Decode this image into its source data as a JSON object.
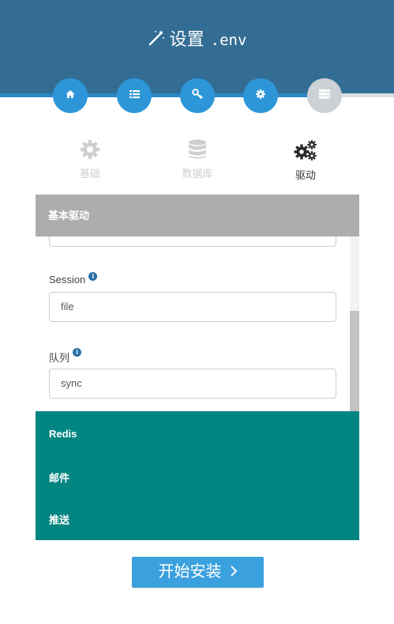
{
  "header": {
    "title": "设置",
    "subtitle": ".env",
    "icon": "magic-wand-icon"
  },
  "steps": [
    {
      "icon": "home-icon",
      "state": "done"
    },
    {
      "icon": "list-icon",
      "state": "done"
    },
    {
      "icon": "key-icon",
      "state": "done"
    },
    {
      "icon": "cog-icon",
      "state": "done"
    },
    {
      "icon": "server-icon",
      "state": "inactive"
    }
  ],
  "tabs": [
    {
      "label": "基础",
      "icon": "cog-icon",
      "active": false
    },
    {
      "label": "数据库",
      "icon": "database-icon",
      "active": false
    },
    {
      "label": "驱动",
      "icon": "cogs-icon",
      "active": true
    }
  ],
  "panel": {
    "title": "基本驱动",
    "fields": [
      {
        "label": "",
        "value": ""
      },
      {
        "label": "Session",
        "value": "file",
        "info_icon": "info-circle-icon"
      },
      {
        "label": "队列",
        "value": "sync",
        "info_icon": "info-circle-icon"
      }
    ],
    "info_glyph": "i"
  },
  "sections": [
    "Redis",
    "邮件",
    "推送"
  ],
  "install_button": {
    "label": "开始安装",
    "icon": "chevron-right-icon"
  },
  "colors": {
    "header_bg": "#336d94",
    "step_blue": "#2c96d8",
    "step_inactive": "#cbd1d4",
    "panel_head": "#adadad",
    "teal": "#038582",
    "button": "#3aa0de"
  }
}
